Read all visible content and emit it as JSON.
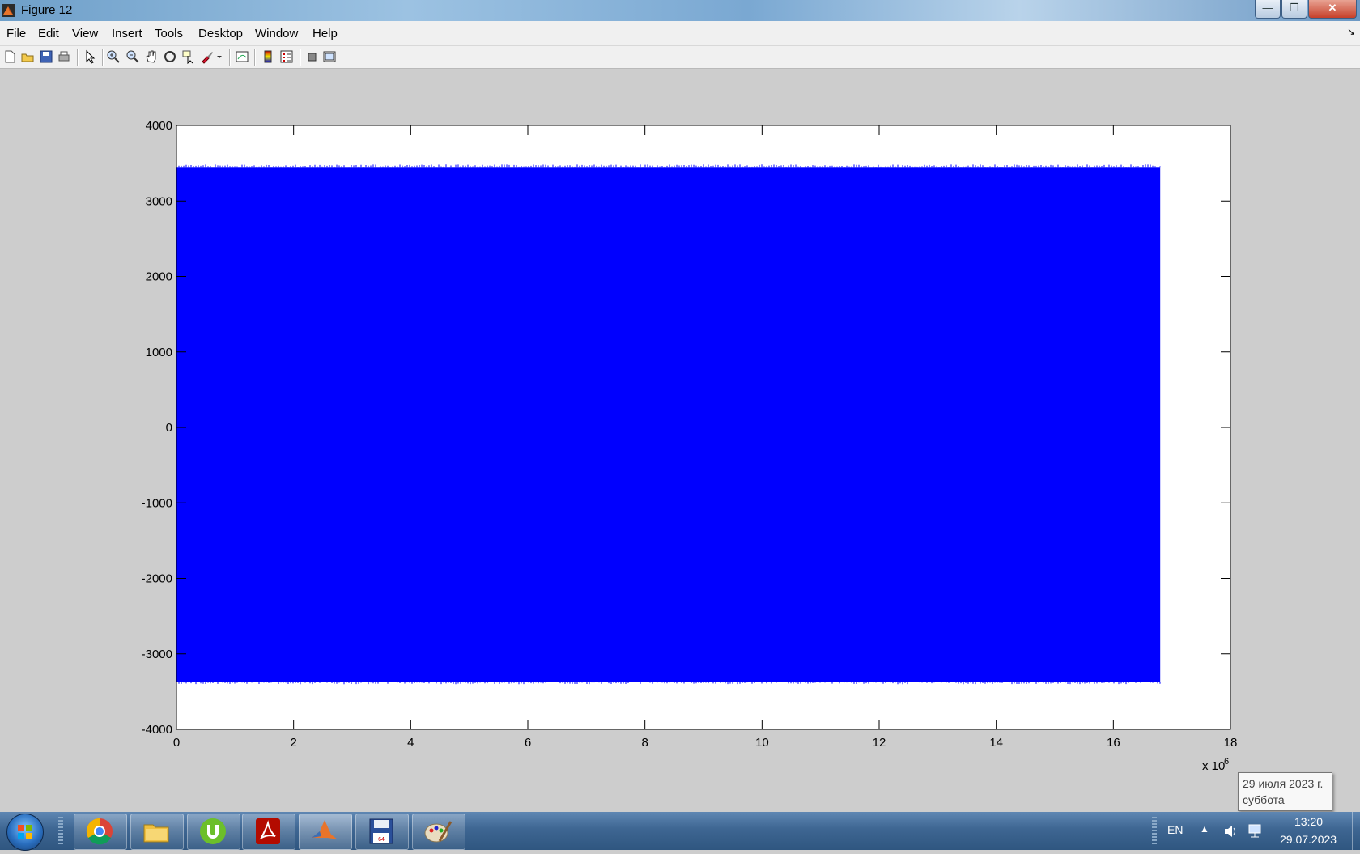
{
  "window": {
    "title": "Figure 12",
    "buttons": {
      "minimize": "—",
      "maximize": "❐",
      "close": "✕"
    }
  },
  "menu": [
    "File",
    "Edit",
    "View",
    "Insert",
    "Tools",
    "Desktop",
    "Window",
    "Help"
  ],
  "toolbar": {
    "icons": [
      "new-figure-icon",
      "open-file-icon",
      "save-icon",
      "print-icon",
      "edit-plot-arrow-icon",
      "zoom-in-icon",
      "zoom-out-icon",
      "pan-hand-icon",
      "rotate-3d-icon",
      "data-cursor-icon",
      "brush-icon",
      "link-plot-icon",
      "colorbar-icon",
      "legend-icon",
      "hide-plot-tools-icon",
      "show-plot-tools-icon"
    ]
  },
  "chart_data": {
    "type": "line",
    "series": [
      {
        "color": "#0000ff",
        "x_range": [
          0,
          16800000
        ],
        "y_range": [
          -3370,
          3450
        ],
        "note_density": "dense"
      }
    ],
    "xlim": [
      0,
      18
    ],
    "ylim": [
      -4000,
      4000
    ],
    "x_ticks": [
      0,
      2,
      4,
      6,
      8,
      10,
      12,
      14,
      16,
      18
    ],
    "y_ticks": [
      -4000,
      -3000,
      -2000,
      -1000,
      0,
      1000,
      2000,
      3000,
      4000
    ],
    "x_exponent_label": "x 10",
    "x_exponent_sup": "6",
    "title": "",
    "xlabel": "",
    "ylabel": "",
    "grid": false
  },
  "taskbar": {
    "apps": [
      "chrome-icon",
      "file-explorer-icon",
      "utorrent-icon",
      "acrobat-icon",
      "matlab-icon",
      "save-disk-icon",
      "paint-icon"
    ],
    "language": "EN",
    "time": "13:20",
    "date": "29.07.2023",
    "tooltip_line1": "29 июля 2023 г.",
    "tooltip_line2": "суббота"
  }
}
